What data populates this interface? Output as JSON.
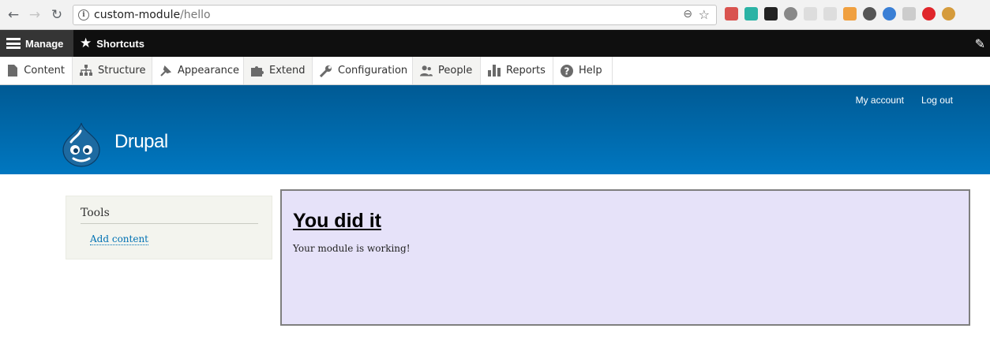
{
  "browser": {
    "url_host": "custom-module",
    "url_path": "/hello"
  },
  "colors": {
    "admin_toolbar": "#0f0f0f",
    "header_gradient_top": "#005a94",
    "header_gradient_bottom": "#0077c0",
    "content_box_bg": "#e6e2f9",
    "link": "#0071b3"
  },
  "toolbar": {
    "manage_label": "Manage",
    "shortcuts_label": "Shortcuts"
  },
  "admin_menu": [
    {
      "label": "Content",
      "icon": "page-icon"
    },
    {
      "label": "Structure",
      "icon": "sitemap-icon"
    },
    {
      "label": "Appearance",
      "icon": "paint-brush-icon"
    },
    {
      "label": "Extend",
      "icon": "puzzle-icon"
    },
    {
      "label": "Configuration",
      "icon": "wrench-icon"
    },
    {
      "label": "People",
      "icon": "people-icon"
    },
    {
      "label": "Reports",
      "icon": "bar-chart-icon"
    },
    {
      "label": "Help",
      "icon": "help-icon"
    }
  ],
  "header": {
    "site_name": "Drupal",
    "secondary_menu": [
      "My account",
      "Log out"
    ]
  },
  "sidebar": {
    "block_title": "Tools",
    "link": "Add content"
  },
  "main": {
    "title": "You did it",
    "body": "Your module is working!"
  }
}
